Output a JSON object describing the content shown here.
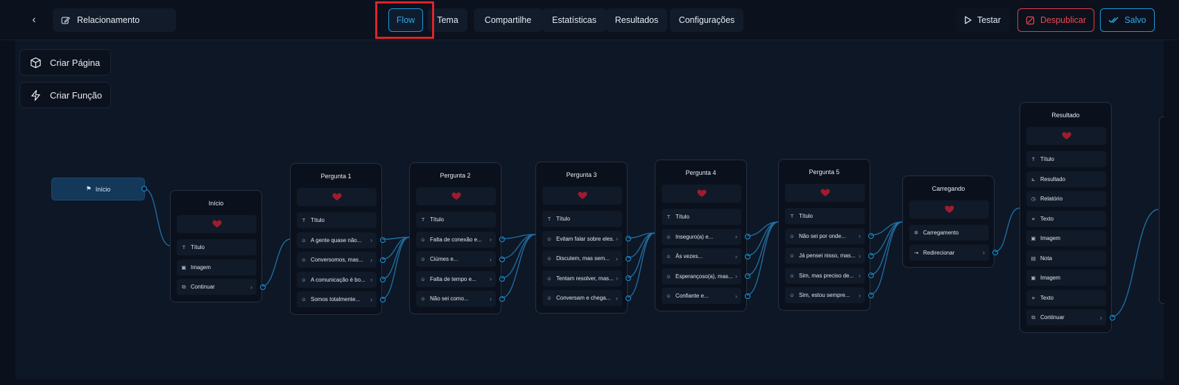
{
  "header": {
    "back_icon": "chevron-left-icon",
    "title_icon": "edit-icon",
    "title": "Relacionamento",
    "tabs": [
      {
        "label": "Flow",
        "active": true
      },
      {
        "label": "Tema",
        "active": false
      },
      {
        "label": "Compartilhe",
        "active": false
      },
      {
        "label": "Estatísticas",
        "active": false
      },
      {
        "label": "Resultados",
        "active": false
      },
      {
        "label": "Configurações",
        "active": false
      }
    ],
    "actions": {
      "test_label": "Testar",
      "unpublish_label": "Despublicar",
      "saved_label": "Salvo"
    }
  },
  "sidebar": {
    "create_page": "Criar Página",
    "create_function": "Criar Função"
  },
  "colors": {
    "accent": "#1b9ee0",
    "danger": "#e0434b",
    "highlight": "#e0242a",
    "heart": "#a11b2e"
  },
  "start_node": {
    "label": "Início"
  },
  "nodes": [
    {
      "title": "Início",
      "rows": [
        {
          "icon": "heart-icon",
          "label": ""
        },
        {
          "icon": "text-icon",
          "label": "Título"
        },
        {
          "icon": "image-icon",
          "label": "Imagem"
        },
        {
          "icon": "continue-icon",
          "label": "Continuar",
          "chevron": true
        }
      ]
    },
    {
      "title": "Pergunta 1",
      "rows": [
        {
          "icon": "heart-icon",
          "label": ""
        },
        {
          "icon": "text-icon",
          "label": "Título"
        },
        {
          "icon": "option-icon",
          "label": "A gente quase não...",
          "chevron": true
        },
        {
          "icon": "option-icon",
          "label": "Conversomos, mas...",
          "chevron": true
        },
        {
          "icon": "option-icon",
          "label": "A comunicação é bo...",
          "chevron": true
        },
        {
          "icon": "option-icon",
          "label": "Somos totalmente...",
          "chevron": true
        }
      ]
    },
    {
      "title": "Pergunta 2",
      "rows": [
        {
          "icon": "heart-icon",
          "label": ""
        },
        {
          "icon": "text-icon",
          "label": "Título"
        },
        {
          "icon": "option-icon",
          "label": "Falta de conexão e...",
          "chevron": true
        },
        {
          "icon": "option-icon",
          "label": "Ciúmes e...",
          "chevron": true
        },
        {
          "icon": "option-icon",
          "label": "Falta de tempo e...",
          "chevron": true
        },
        {
          "icon": "option-icon",
          "label": "Não sei como...",
          "chevron": true
        }
      ]
    },
    {
      "title": "Pergunta 3",
      "rows": [
        {
          "icon": "heart-icon",
          "label": ""
        },
        {
          "icon": "text-icon",
          "label": "Título"
        },
        {
          "icon": "option-icon",
          "label": "Evitam falar sobre eles.",
          "chevron": true
        },
        {
          "icon": "option-icon",
          "label": "Discutem, mas sem...",
          "chevron": true
        },
        {
          "icon": "option-icon",
          "label": "Tentam resolver, mas...",
          "chevron": true
        },
        {
          "icon": "option-icon",
          "label": "Conversam e chega...",
          "chevron": true
        }
      ]
    },
    {
      "title": "Pergunta 4",
      "rows": [
        {
          "icon": "heart-icon",
          "label": ""
        },
        {
          "icon": "text-icon",
          "label": "Título"
        },
        {
          "icon": "option-icon",
          "label": "Inseguro(a) e...",
          "chevron": true
        },
        {
          "icon": "option-icon",
          "label": "Às vezes...",
          "chevron": true
        },
        {
          "icon": "option-icon",
          "label": "Esperançoso(a), mas...",
          "chevron": true
        },
        {
          "icon": "option-icon",
          "label": "Confiante e...",
          "chevron": true
        }
      ]
    },
    {
      "title": "Pergunta 5",
      "rows": [
        {
          "icon": "heart-icon",
          "label": ""
        },
        {
          "icon": "text-icon",
          "label": "Título"
        },
        {
          "icon": "option-icon",
          "label": "Não sei por onde...",
          "chevron": true
        },
        {
          "icon": "option-icon",
          "label": "Já pensei nisso, mas...",
          "chevron": true
        },
        {
          "icon": "option-icon",
          "label": "Sim, mas preciso de...",
          "chevron": true
        },
        {
          "icon": "option-icon",
          "label": "Sim, estou sempre...",
          "chevron": true
        }
      ]
    },
    {
      "title": "Carregando",
      "rows": [
        {
          "icon": "heart-icon",
          "label": ""
        },
        {
          "icon": "loading-icon",
          "label": "Carregamento"
        },
        {
          "icon": "redirect-icon",
          "label": "Redirecionar",
          "chevron": true
        }
      ]
    },
    {
      "title": "Resultado",
      "rows": [
        {
          "icon": "heart-icon",
          "label": ""
        },
        {
          "icon": "text-icon",
          "label": "Título"
        },
        {
          "icon": "chart-icon",
          "label": "Resultado"
        },
        {
          "icon": "clock-icon",
          "label": "Relatório"
        },
        {
          "icon": "paragraph-icon",
          "label": "Texto"
        },
        {
          "icon": "image-icon",
          "label": "Imagem"
        },
        {
          "icon": "note-icon",
          "label": "Nota"
        },
        {
          "icon": "image-icon",
          "label": "Imagem"
        },
        {
          "icon": "paragraph-icon",
          "label": "Texto"
        },
        {
          "icon": "continue-icon",
          "label": "Continuar",
          "chevron": true
        }
      ]
    }
  ]
}
